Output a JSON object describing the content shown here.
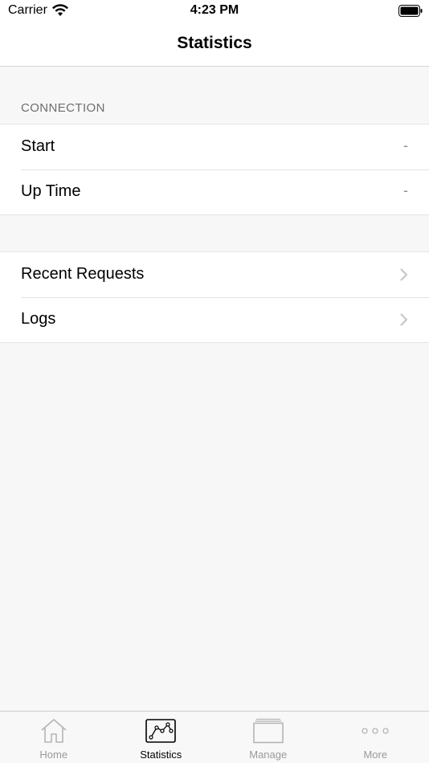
{
  "status_bar": {
    "carrier": "Carrier",
    "time": "4:23 PM"
  },
  "nav": {
    "title": "Statistics"
  },
  "connection_section": {
    "header": "CONNECTION",
    "rows": [
      {
        "label": "Start",
        "value": "-"
      },
      {
        "label": "Up Time",
        "value": "-"
      }
    ]
  },
  "links_section": {
    "rows": [
      {
        "label": "Recent Requests"
      },
      {
        "label": "Logs"
      }
    ]
  },
  "tab_bar": {
    "active_color": "#000000",
    "inactive_color": "#9a9a9a",
    "tabs": [
      {
        "label": "Home",
        "icon": "house-icon",
        "active": false
      },
      {
        "label": "Statistics",
        "icon": "chart-icon",
        "active": true
      },
      {
        "label": "Manage",
        "icon": "stack-icon",
        "active": false
      },
      {
        "label": "More",
        "icon": "ellipsis-icon",
        "active": false
      }
    ]
  }
}
